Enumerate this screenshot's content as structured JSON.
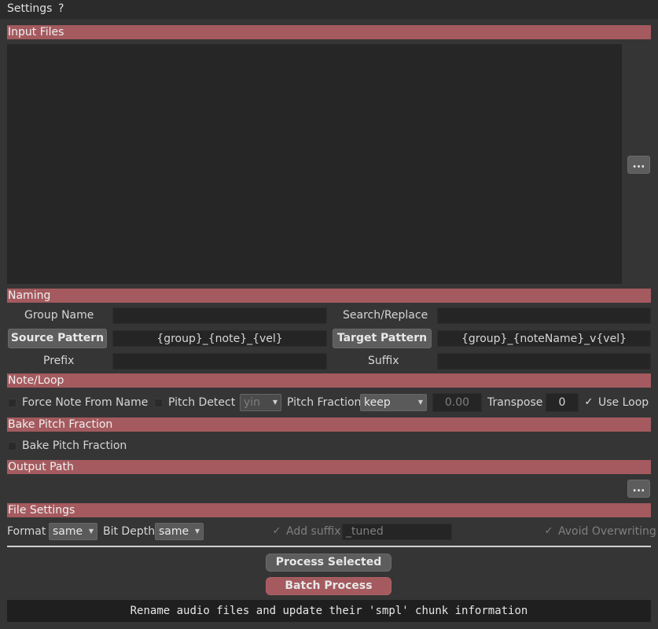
{
  "menu": {
    "settings": "Settings",
    "help": "?"
  },
  "sections": {
    "input_files": "Input Files",
    "naming": "Naming",
    "note_loop": "Note/Loop",
    "bake_pitch": "Bake Pitch Fraction",
    "output_path": "Output Path",
    "file_settings": "File Settings"
  },
  "input": {
    "browse": "..."
  },
  "naming": {
    "group_name_label": "Group Name",
    "group_name_value": "",
    "search_replace_label": "Search/Replace",
    "search_replace_value": "",
    "source_pattern_button": "Source Pattern",
    "source_pattern_value": "{group}_{note}_{vel}",
    "target_pattern_button": "Target Pattern",
    "target_pattern_value": "{group}_{noteName}_v{vel}",
    "prefix_label": "Prefix",
    "prefix_value": "",
    "suffix_label": "Suffix",
    "suffix_value": ""
  },
  "note_loop": {
    "force_note_label": "Force Note From Name",
    "force_note_checked": false,
    "pitch_detect_label": "Pitch Detect",
    "pitch_detect_checked": false,
    "pitch_method": "yin",
    "pitch_fraction_label": "Pitch Fraction",
    "pitch_fraction_mode": "keep",
    "pitch_fraction_value": "0.00",
    "transpose_label": "Transpose",
    "transpose_value": "0",
    "use_loop_label": "Use Loop",
    "use_loop_checked": true,
    "check_mark": "✓"
  },
  "bake": {
    "label": "Bake Pitch Fraction",
    "checked": false
  },
  "output": {
    "browse": "..."
  },
  "file_settings": {
    "format_label": "Format",
    "format_value": "same",
    "bit_depth_label": "Bit Depth",
    "bit_depth_value": "same",
    "add_suffix_label": "Add suffix",
    "add_suffix_value": "_tuned",
    "avoid_overwriting_label": "Avoid Overwriting"
  },
  "actions": {
    "process_selected": "Process Selected",
    "batch_process": "Batch Process"
  },
  "status": "Rename audio files and update their 'smpl' chunk information",
  "colors": {
    "section_header": "#a45a5e",
    "batch_button": "#a45a5e",
    "background": "#353535"
  }
}
